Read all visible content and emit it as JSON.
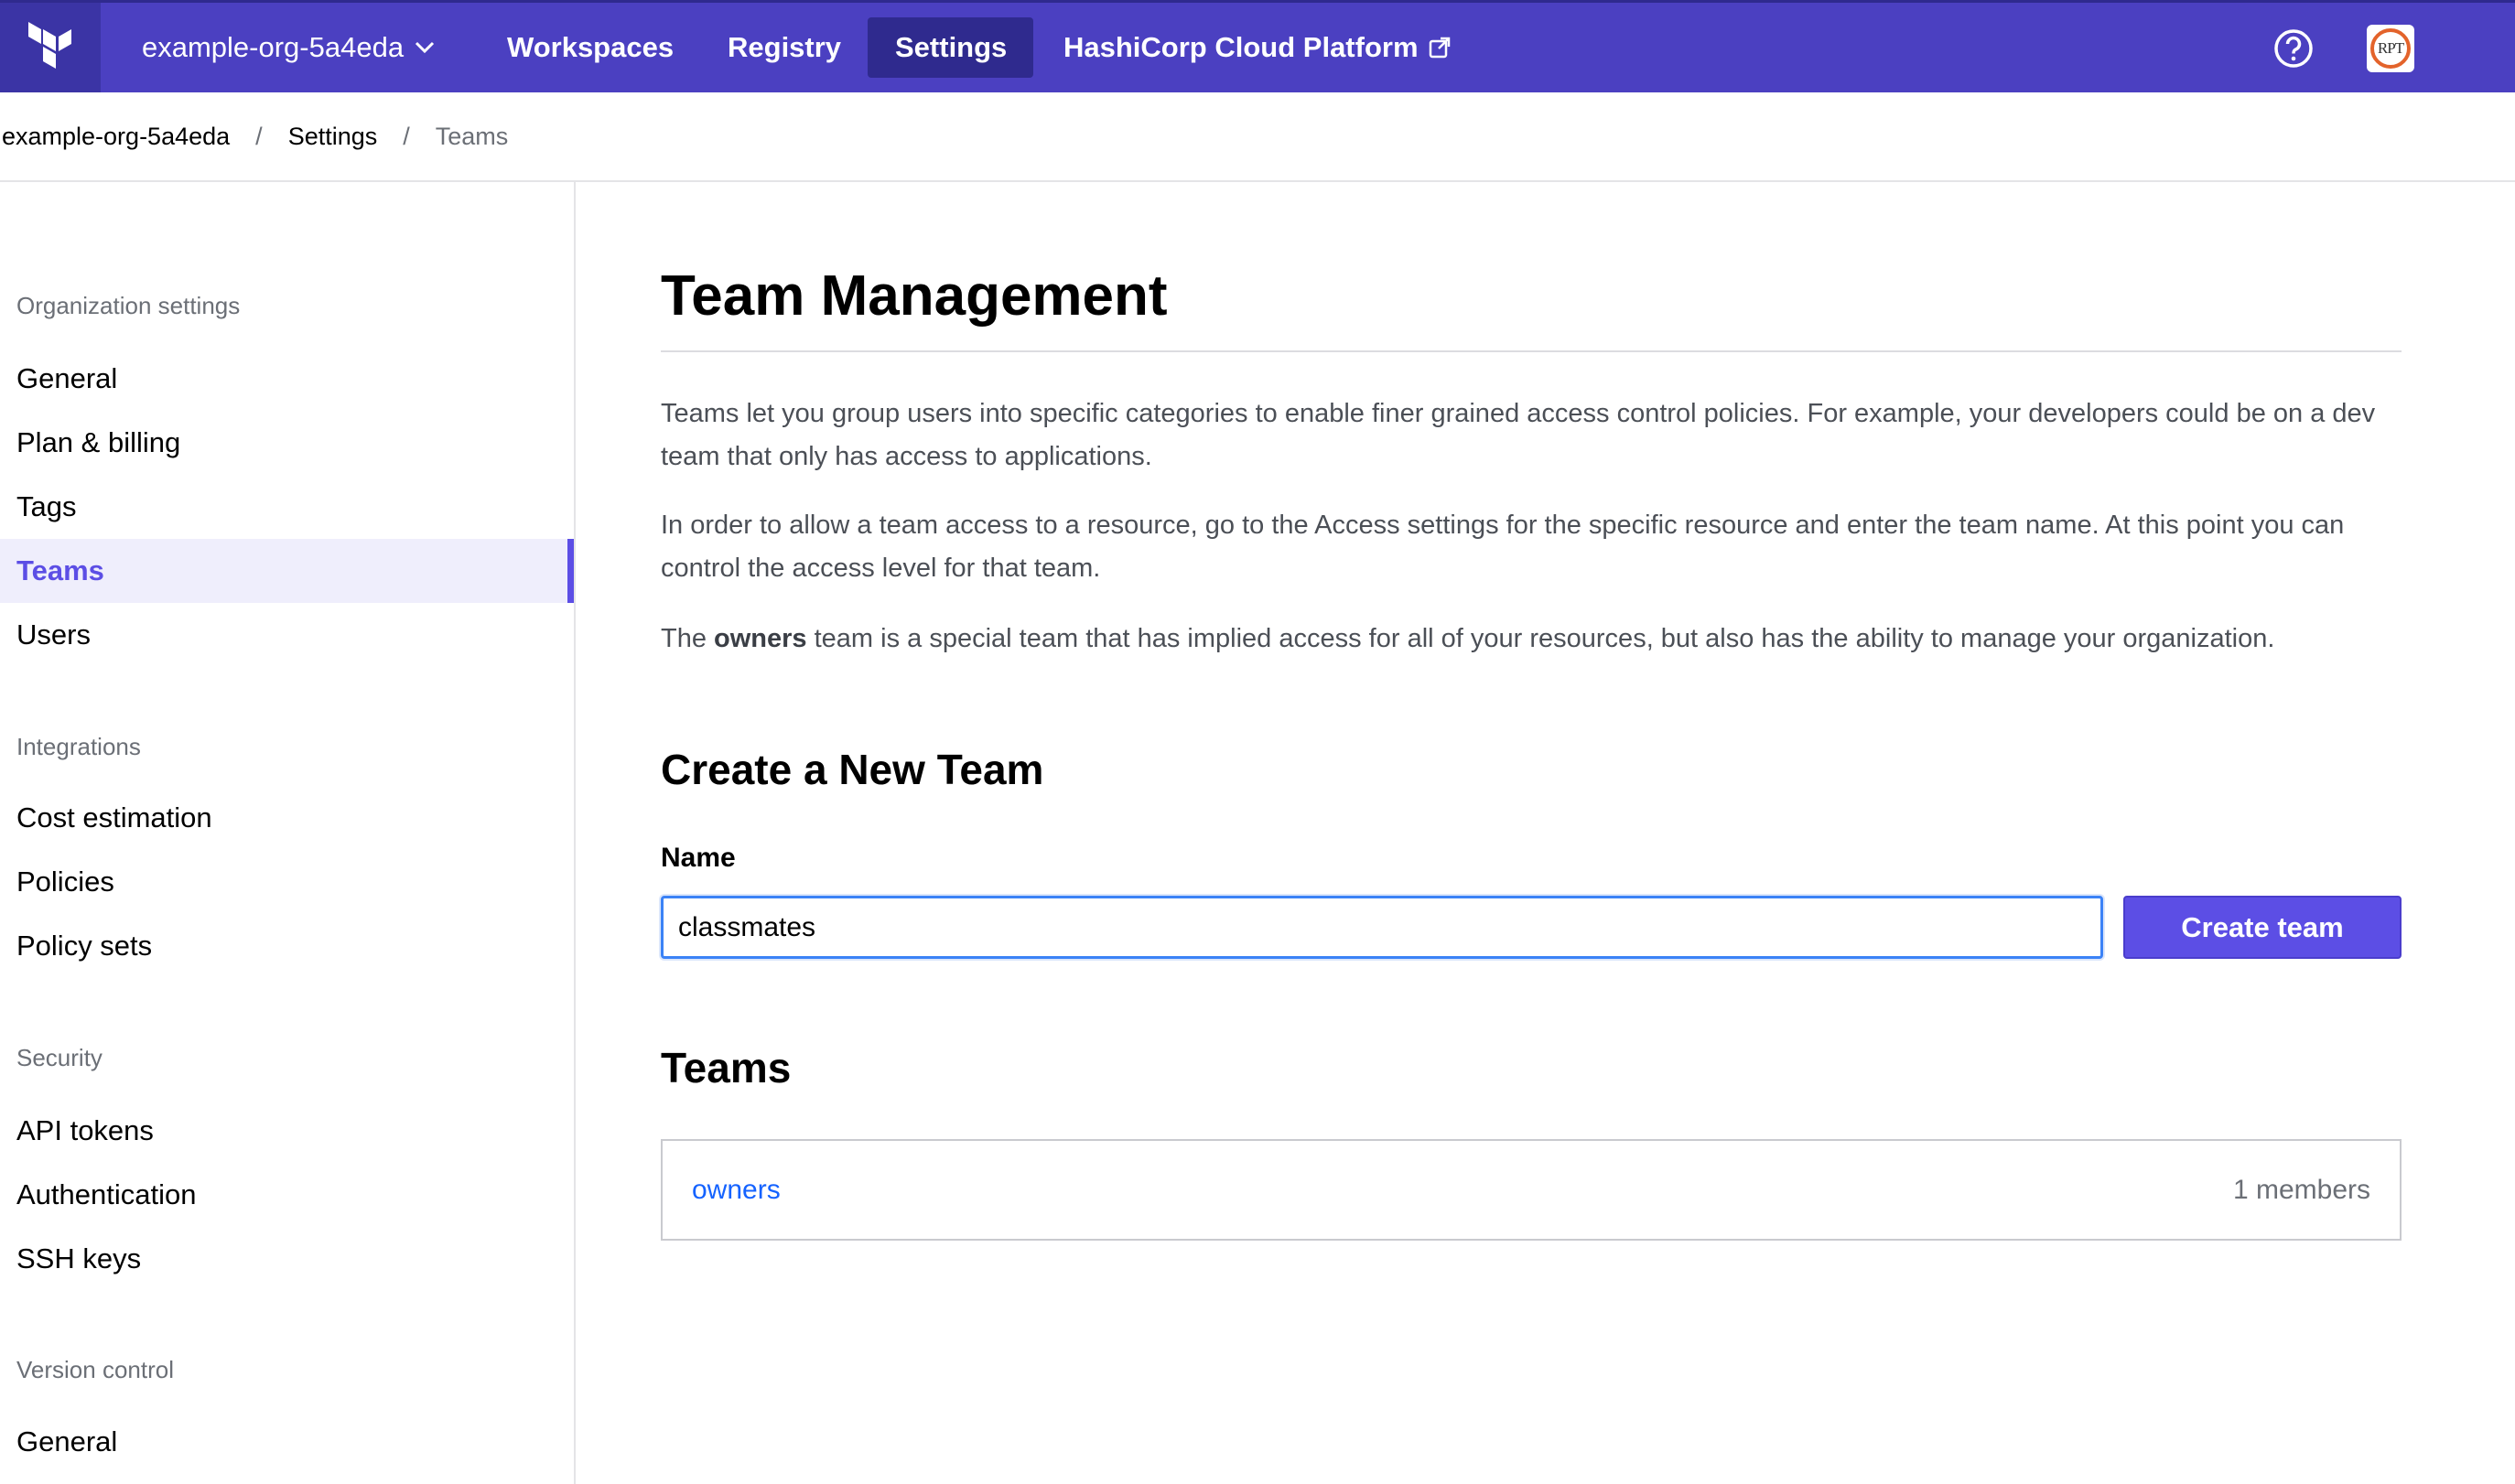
{
  "topnav": {
    "org_name": "example-org-5a4eda",
    "links": [
      "Workspaces",
      "Registry",
      "Settings",
      "HashiCorp Cloud Platform"
    ],
    "active_link": "Settings",
    "avatar_text": "RPT",
    "colors": {
      "nav_bg": "#4b40c1",
      "logo_bg": "#3b34a5",
      "active_bg": "#2f2a8e"
    },
    "icons": [
      "terraform-logo-icon",
      "chevron-down-icon",
      "external-link-icon",
      "help-icon"
    ]
  },
  "breadcrumb": [
    "example-org-5a4eda",
    "Settings",
    "Teams"
  ],
  "sidebar": {
    "sections": [
      {
        "heading": "Organization settings",
        "items": [
          "General",
          "Plan & billing",
          "Tags",
          "Teams",
          "Users"
        ]
      },
      {
        "heading": "Integrations",
        "items": [
          "Cost estimation",
          "Policies",
          "Policy sets"
        ]
      },
      {
        "heading": "Security",
        "items": [
          "API tokens",
          "Authentication",
          "SSH keys"
        ]
      },
      {
        "heading": "Version control",
        "items": [
          "General"
        ]
      }
    ],
    "active_item": "Teams",
    "accent_color": "#5c4ee5"
  },
  "main": {
    "title": "Team Management",
    "paragraph_1": "Teams let you group users into specific categories to enable finer grained access control policies. For example, your developers could be on a dev team that only has access to applications.",
    "paragraph_2": "In order to allow a team access to a resource, go to the Access settings for the specific resource and enter the team name. At this point you can control the access level for that team.",
    "paragraph_3_prefix": "The ",
    "paragraph_3_bold": "owners",
    "paragraph_3_suffix": " team is a special team that has implied access for all of your resources, but also has the ability to manage your organization.",
    "create_heading": "Create a New Team",
    "name_label": "Name",
    "name_value": "classmates",
    "create_button": "Create team",
    "teams_heading": "Teams",
    "teams": [
      {
        "name": "owners",
        "members": "1 members"
      }
    ]
  }
}
